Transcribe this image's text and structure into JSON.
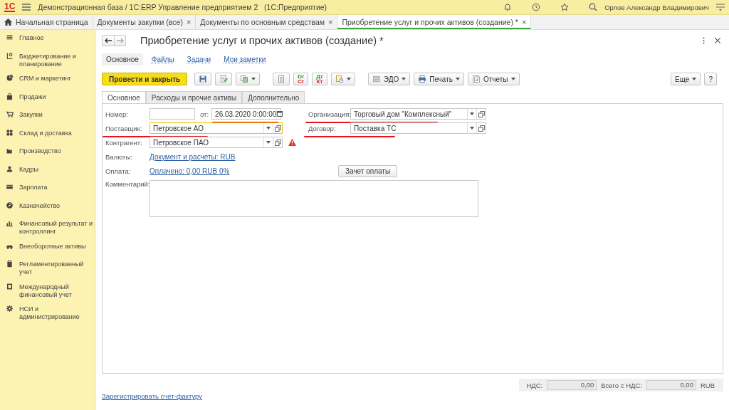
{
  "header": {
    "logo": "1С",
    "title": "Демонстрационная база / 1С:ERP Управление предприятием 2   (1С:Предприятие)",
    "user": "Орлов Александр Владимирович"
  },
  "tabs": [
    {
      "label": "Начальная страница",
      "selected": false,
      "kind": "home"
    },
    {
      "label": "Документы закупки (все)",
      "selected": false,
      "kind": "doc",
      "close": "×"
    },
    {
      "label": "Документы по основным средствам",
      "selected": false,
      "kind": "doc",
      "close": "×"
    },
    {
      "label": "Приобретение услуг и прочих активов (создание) *",
      "selected": true,
      "kind": "doc",
      "close": "×"
    }
  ],
  "sidebar": {
    "items": [
      {
        "label": "Главное"
      },
      {
        "label": "Бюджетирование и планирование"
      },
      {
        "label": "CRM и маркетинг"
      },
      {
        "label": "Продажи"
      },
      {
        "label": "Закупки"
      },
      {
        "label": "Склад и доставка"
      },
      {
        "label": "Производство"
      },
      {
        "label": "Кадры"
      },
      {
        "label": "Зарплата"
      },
      {
        "label": "Казначейство"
      },
      {
        "label": "Финансовый результат и контроллинг"
      },
      {
        "label": "Внеоборотные активы"
      },
      {
        "label": "Регламентированный учет"
      },
      {
        "label": "Международный финансовый учет"
      },
      {
        "label": "НСИ и администрирование"
      }
    ]
  },
  "form": {
    "title": "Приобретение услуг и прочих активов (создание) *",
    "sections": [
      {
        "label": "Основное",
        "selected": true
      },
      {
        "label": "Файлы",
        "selected": false
      },
      {
        "label": "Задачи",
        "selected": false
      },
      {
        "label": "Мои заметки",
        "selected": false
      }
    ],
    "toolbar": [
      {
        "kind": "primary",
        "label": "Провести и закрыть"
      },
      {
        "kind": "icon"
      },
      {
        "kind": "icon"
      },
      {
        "kind": "icon-dropdown"
      },
      {
        "kind": "icon"
      },
      {
        "kind": "ledger",
        "top": "Dr",
        "bottom": "Cr"
      },
      {
        "kind": "ledger",
        "top": "Дт",
        "bottom": "Кт"
      },
      {
        "kind": "icon-dropdown"
      },
      {
        "kind": "dropdown",
        "label": "ЭДО"
      },
      {
        "kind": "dropdown",
        "label": "Печать"
      },
      {
        "kind": "dropdown",
        "label": "Отчеты"
      }
    ],
    "toolbar_right": [
      {
        "label": "Еще",
        "kind": "dropdown"
      },
      {
        "label": "?",
        "kind": "help"
      }
    ],
    "tabs": [
      {
        "label": "Основное",
        "selected": true
      },
      {
        "label": "Расходы и прочие активы",
        "selected": false
      },
      {
        "label": "Дополнительно",
        "selected": false
      }
    ],
    "number": {
      "label": "Номер:",
      "date_label": "от:",
      "date": "26.03.2020  0:00:00",
      "date_marked": true
    },
    "supplier": {
      "label": "Поставщик:",
      "value": "Петровское АО",
      "focused": true,
      "marked": true
    },
    "counterparty": {
      "label": "Контрагент:",
      "value": "Петровское ПАО",
      "warning": true
    },
    "organization": {
      "label": "Организация:",
      "value": "Торговый дом \"Комплексный\"",
      "marked": true
    },
    "contract": {
      "label": "Договор:",
      "value": "Поставка ТС",
      "marked": true
    },
    "currency": {
      "label": "Валюты:",
      "link": "Документ и расчеты: RUB"
    },
    "payment": {
      "label": "Оплата:",
      "link": "Оплачено: 0,00 RUB  0%",
      "button": "Зачет оплаты"
    },
    "comment": {
      "label": "Комментарий:"
    },
    "totals": {
      "vat_label": "НДС:",
      "vat": "0,00",
      "total_label": "Всего с НДС:",
      "total": "0,00",
      "currency": "RUB"
    },
    "footer_link": "Зарегистрировать счет-фактуру"
  }
}
